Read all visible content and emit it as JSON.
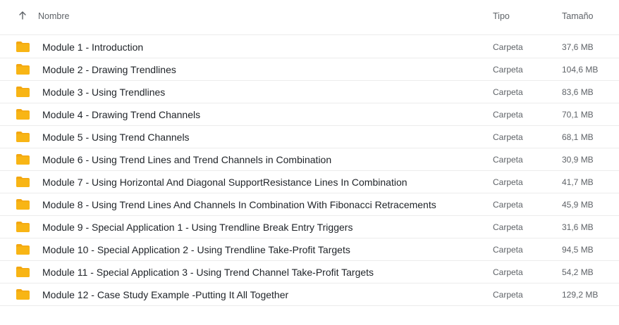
{
  "header": {
    "name_label": "Nombre",
    "type_label": "Tipo",
    "size_label": "Tamaño",
    "sort_icon": "arrow-up-icon"
  },
  "colors": {
    "folder": "#F8B515",
    "folder_tab": "#F3A711"
  },
  "rows": [
    {
      "name": "Module 1 - Introduction",
      "type": "Carpeta",
      "size": "37,6 MB"
    },
    {
      "name": "Module 2 - Drawing Trendlines",
      "type": "Carpeta",
      "size": "104,6 MB"
    },
    {
      "name": "Module 3 - Using Trendlines",
      "type": "Carpeta",
      "size": "83,6 MB"
    },
    {
      "name": "Module 4 - Drawing Trend Channels",
      "type": "Carpeta",
      "size": "70,1 MB"
    },
    {
      "name": "Module 5 - Using Trend Channels",
      "type": "Carpeta",
      "size": "68,1 MB"
    },
    {
      "name": "Module 6 - Using Trend Lines and Trend Channels in Combination",
      "type": "Carpeta",
      "size": "30,9 MB"
    },
    {
      "name": "Module 7 - Using Horizontal And Diagonal SupportResistance Lines In Combination",
      "type": "Carpeta",
      "size": "41,7 MB"
    },
    {
      "name": "Module 8 - Using Trend Lines And Channels In Combination With Fibonacci Retracements",
      "type": "Carpeta",
      "size": "45,9 MB"
    },
    {
      "name": "Module 9 - Special Application 1 - Using Trendline Break Entry Triggers",
      "type": "Carpeta",
      "size": "31,6 MB"
    },
    {
      "name": "Module 10 - Special Application 2 - Using Trendline Take-Profit Targets",
      "type": "Carpeta",
      "size": "94,5 MB"
    },
    {
      "name": "Module 11 - Special Application 3 - Using Trend Channel Take-Profit Targets",
      "type": "Carpeta",
      "size": "54,2 MB"
    },
    {
      "name": "Module 12 - Case Study Example -Putting It All Together",
      "type": "Carpeta",
      "size": "129,2 MB"
    }
  ]
}
